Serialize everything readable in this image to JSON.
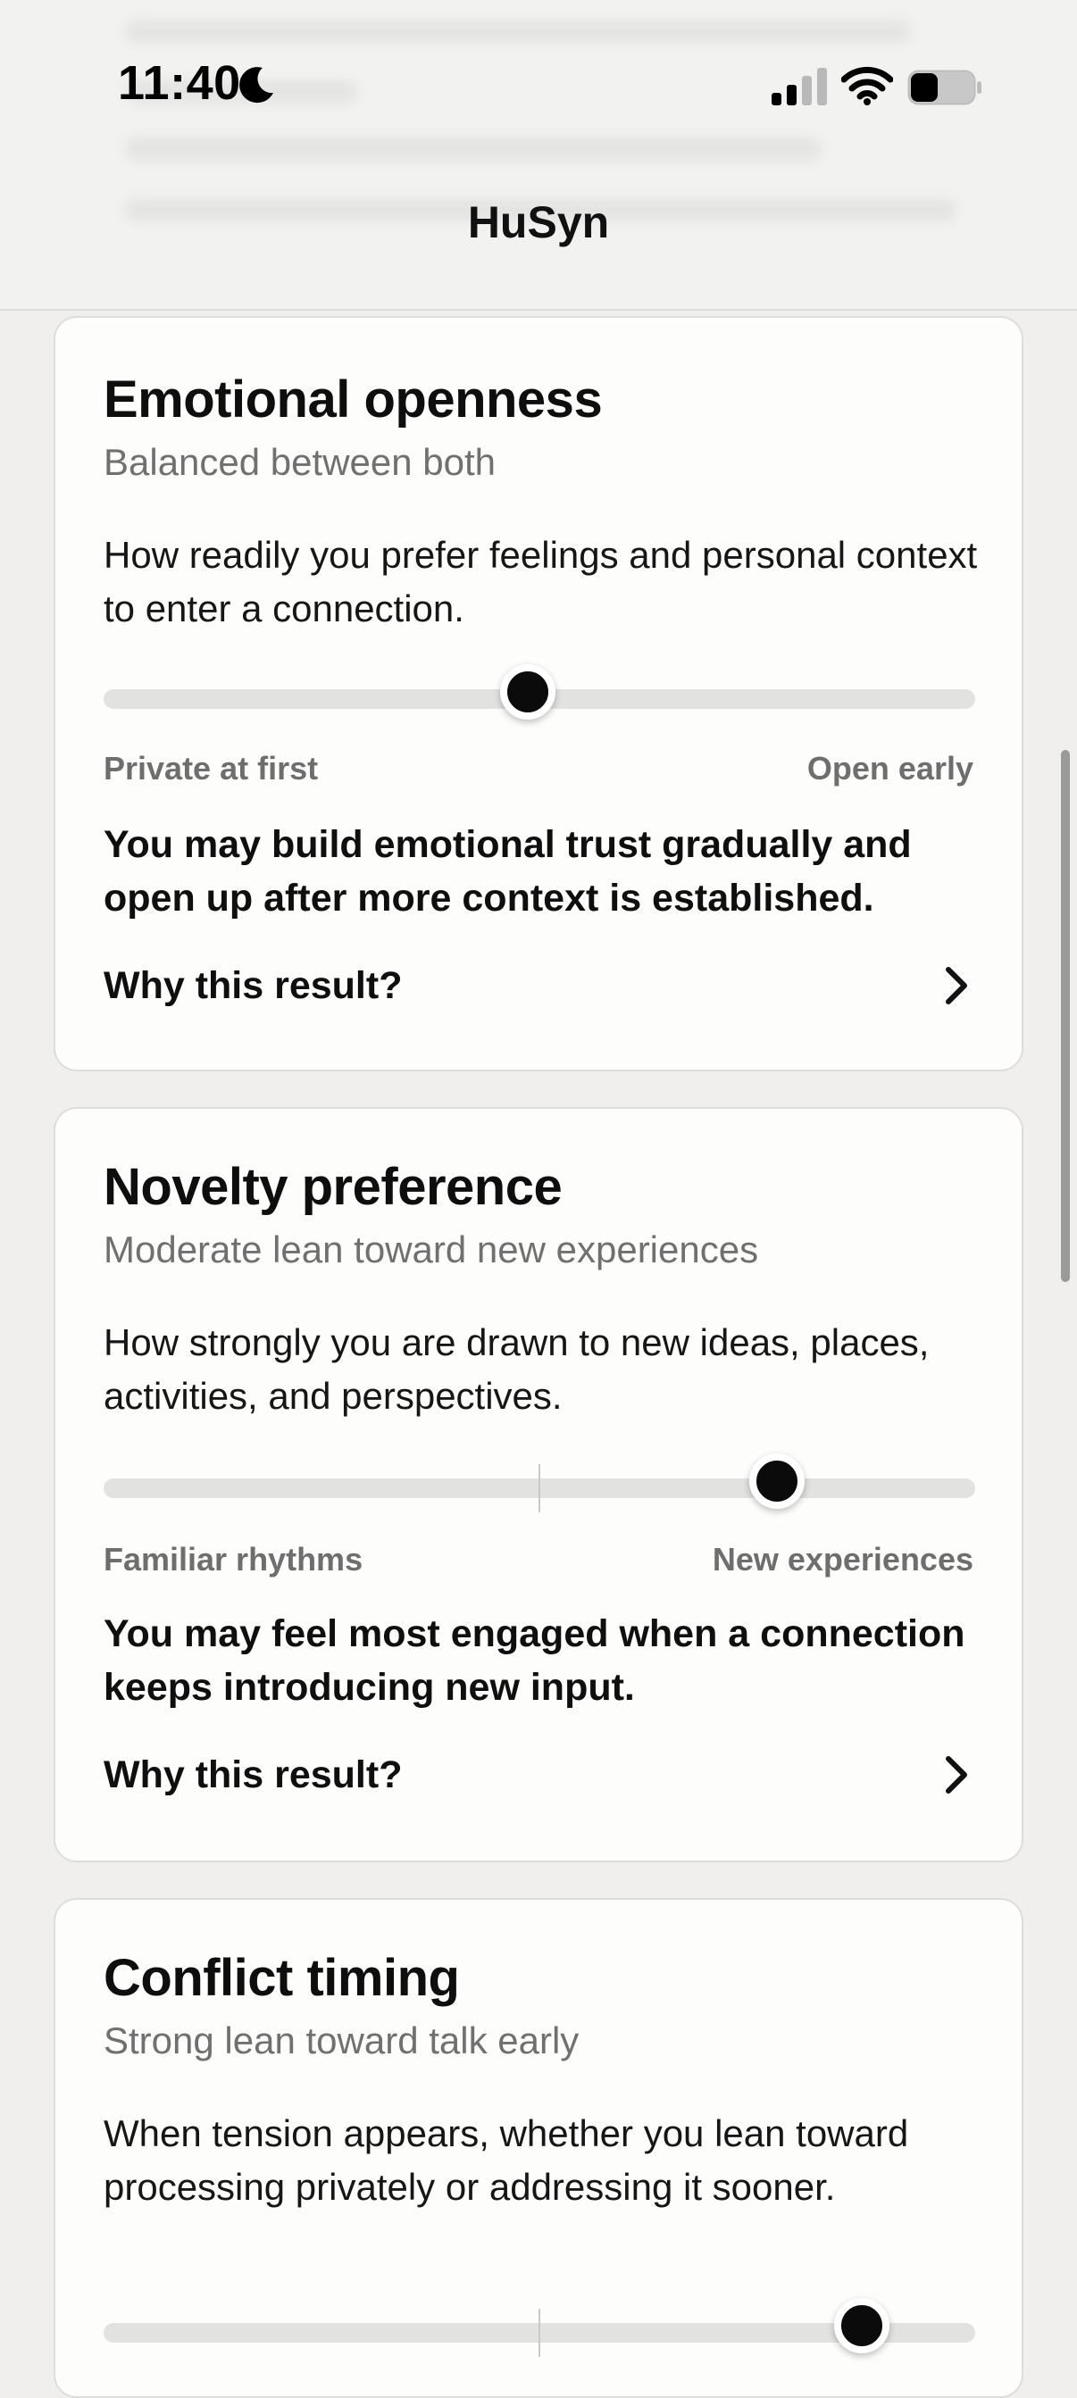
{
  "status": {
    "time": "11:40"
  },
  "header": {
    "title": "HuSyn"
  },
  "cards": [
    {
      "title": "Emotional openness",
      "subtitle": "Balanced between both",
      "description": "How readily you prefer feelings and personal context to enter a connection.",
      "slider_value": 0.487,
      "left_label": "Private at first",
      "right_label": "Open early",
      "result": "You may build emotional trust gradually and open up after more context is established.",
      "why_label": "Why this result?"
    },
    {
      "title": "Novelty preference",
      "subtitle": "Moderate lean toward new experiences",
      "description": "How strongly you are drawn to new ideas, places, activities, and perspectives.",
      "slider_value": 0.773,
      "left_label": "Familiar rhythms",
      "right_label": "New experiences",
      "result": "You may feel most engaged when a connection keeps introducing new input.",
      "why_label": "Why this result?"
    },
    {
      "title": "Conflict timing",
      "subtitle": "Strong lean toward talk early",
      "description": "When tension appears, whether you lean toward processing privately or addressing it sooner.",
      "slider_value": 0.87
    }
  ],
  "colors": {
    "background": "#f0efed",
    "card": "#fdfdfb",
    "thumb": "#0b0b0b",
    "track": "#e2e2e0",
    "muted_text": "#707070"
  },
  "icons": [
    "moon-icon",
    "cellular-signal-icon",
    "wifi-icon",
    "battery-icon",
    "chevron-right-icon"
  ]
}
